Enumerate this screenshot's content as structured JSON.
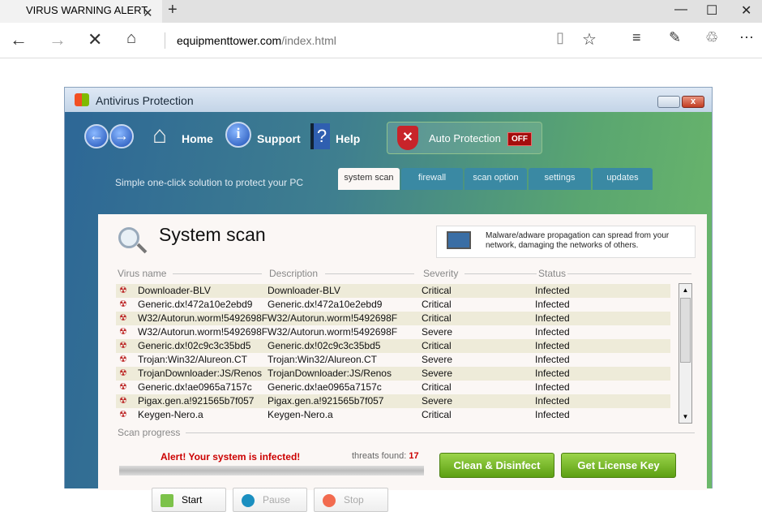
{
  "browser": {
    "tab_title": "VIRUS WARNING ALERT",
    "url_domain": "equipmenttower.com",
    "url_path": "/index.html"
  },
  "app": {
    "title": "Antivirus Protection",
    "nav": {
      "home": "Home",
      "support": "Support",
      "help": "Help"
    },
    "auto_protection": {
      "label": "Auto Protection",
      "state": "OFF"
    },
    "slogan": "Simple one-click solution to protect your PC",
    "tabs": [
      "system scan",
      "firewall",
      "scan option",
      "settings",
      "updates"
    ],
    "heading": "System scan",
    "info_text": "Malware/adware propagation can spread from your network, damaging the networks of others.",
    "columns": [
      "Virus name",
      "Description",
      "Severity",
      "Status"
    ],
    "rows": [
      [
        "Downloader-BLV",
        "Downloader-BLV",
        "Critical",
        "Infected"
      ],
      [
        "Generic.dx!472a10e2ebd9",
        "Generic.dx!472a10e2ebd9",
        "Critical",
        "Infected"
      ],
      [
        "W32/Autorun.worm!5492698F",
        "W32/Autorun.worm!5492698F",
        "Critical",
        "Infected"
      ],
      [
        "W32/Autorun.worm!5492698F",
        "W32/Autorun.worm!5492698F",
        "Severe",
        "Infected"
      ],
      [
        "Generic.dx!02c9c3c35bd5",
        "Generic.dx!02c9c3c35bd5",
        "Critical",
        "Infected"
      ],
      [
        "Trojan:Win32/Alureon.CT",
        "Trojan:Win32/Alureon.CT",
        "Severe",
        "Infected"
      ],
      [
        "TrojanDownloader:JS/Renos",
        "TrojanDownloader:JS/Renos",
        "Severe",
        "Infected"
      ],
      [
        "Generic.dx!ae0965a7157c",
        "Generic.dx!ae0965a7157c",
        "Critical",
        "Infected"
      ],
      [
        "Pigax.gen.a!921565b7f057",
        "Pigax.gen.a!921565b7f057",
        "Severe",
        "Infected"
      ],
      [
        "Keygen-Nero.a",
        "Keygen-Nero.a",
        "Critical",
        "Infected"
      ]
    ],
    "scan_progress_label": "Scan progress",
    "alert": "Alert! Your system is infected!",
    "threats_label": "threats found:",
    "threats_count": "17",
    "clean_button": "Clean & Disinfect",
    "license_button": "Get License Key",
    "start": "Start",
    "pause": "Pause",
    "stop": "Stop"
  }
}
